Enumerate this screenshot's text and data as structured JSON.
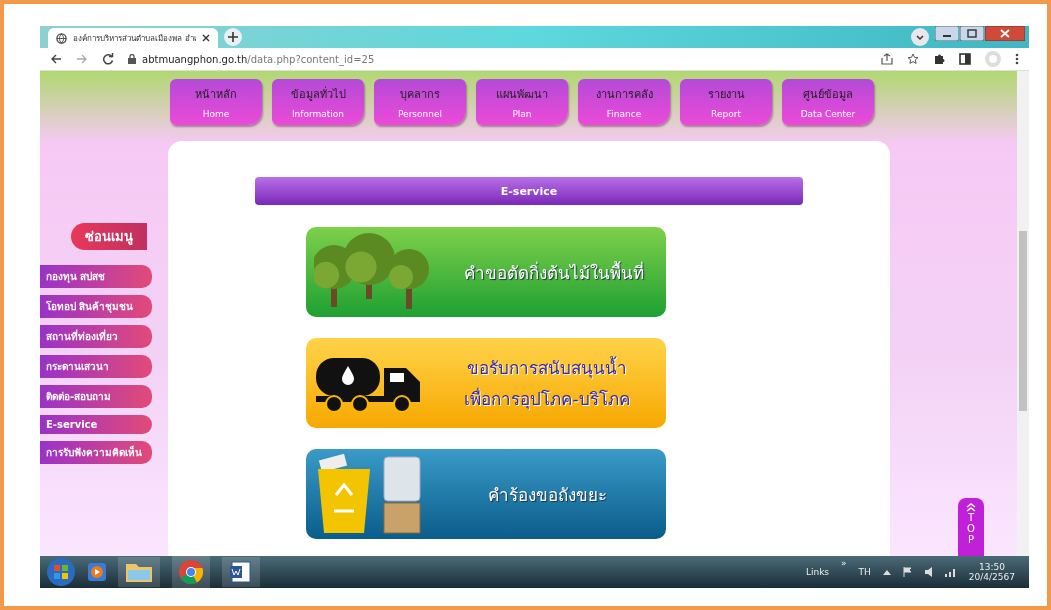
{
  "browser": {
    "tab_title": "องค์การบริหารส่วนตำบลเมืองพล อำเ",
    "url_host": "abtmuangphon.go.th",
    "url_path": "/data.php?content_id=25"
  },
  "nav": [
    {
      "thai": "หน้าหลัก",
      "english": "Home"
    },
    {
      "thai": "ข้อมูลทั่วไป",
      "english": "Information"
    },
    {
      "thai": "บุคลากร",
      "english": "Personnel"
    },
    {
      "thai": "แผนพัฒนา",
      "english": "Plan"
    },
    {
      "thai": "งานการคลัง",
      "english": "Finance"
    },
    {
      "thai": "รายงาน",
      "english": "Report"
    },
    {
      "thai": "ศูนย์ข้อมูล",
      "english": "Data Center"
    }
  ],
  "sidebar": {
    "heading": "ซ่อนเมนู",
    "items": [
      "กองทุน สปสช",
      "โอทอป สินค้าชุมชน",
      "สถานที่ท่องเที่ยว",
      "กระดานเสวนา",
      "ติดต่อ-สอบถาม",
      "E-service",
      "การรับฟังความคิดเห็น"
    ]
  },
  "section_title": "E-service",
  "services": [
    {
      "kind": "trees",
      "lines": [
        "คำขอตัดกิ่งต้นไม้ในพื้นที่"
      ]
    },
    {
      "kind": "truck",
      "lines": [
        "ขอรับการสนับสนุนน้ำ",
        "เพื่อการอุปโภค-บริโภค"
      ]
    },
    {
      "kind": "bin",
      "lines": [
        "คำร้องขอถังขยะ"
      ]
    }
  ],
  "top_button": [
    "T",
    "O",
    "P"
  ],
  "taskbar": {
    "links": "Links",
    "chevron": "»",
    "language": "TH",
    "time": "13:50",
    "date": "20/4/2567"
  }
}
